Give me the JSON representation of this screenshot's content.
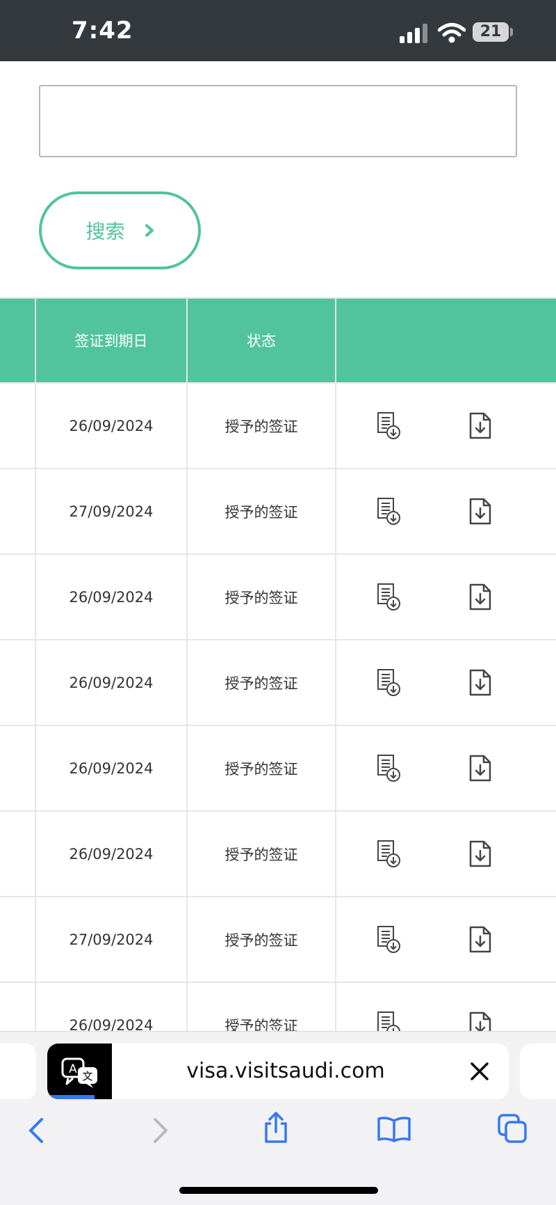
{
  "status_bar": {
    "time": "7:42",
    "battery": "21"
  },
  "search": {
    "input_value": "",
    "button_label": "搜索"
  },
  "table": {
    "headers": [
      "签证到期日",
      "状态"
    ],
    "rows": [
      {
        "expiry": "26/09/2024",
        "status": "授予的签证"
      },
      {
        "expiry": "27/09/2024",
        "status": "授予的签证"
      },
      {
        "expiry": "26/09/2024",
        "status": "授予的签证"
      },
      {
        "expiry": "26/09/2024",
        "status": "授予的签证"
      },
      {
        "expiry": "26/09/2024",
        "status": "授予的签证"
      },
      {
        "expiry": "26/09/2024",
        "status": "授予的签证"
      },
      {
        "expiry": "27/09/2024",
        "status": "授予的签证"
      },
      {
        "expiry": "26/09/2024",
        "status": "授予的签证"
      }
    ]
  },
  "browser": {
    "url": "visa.visitsaudi.com"
  },
  "colors": {
    "accent": "#52c49d",
    "status_bar_bg": "#33393d",
    "link_blue": "#3478f6"
  },
  "icons": [
    "signal-icon",
    "wifi-icon",
    "battery-icon",
    "chevron-right-icon",
    "document-download-icon",
    "file-download-icon",
    "translate-icon",
    "close-icon",
    "back-icon",
    "forward-icon",
    "share-icon",
    "bookmarks-icon",
    "tabs-icon"
  ]
}
